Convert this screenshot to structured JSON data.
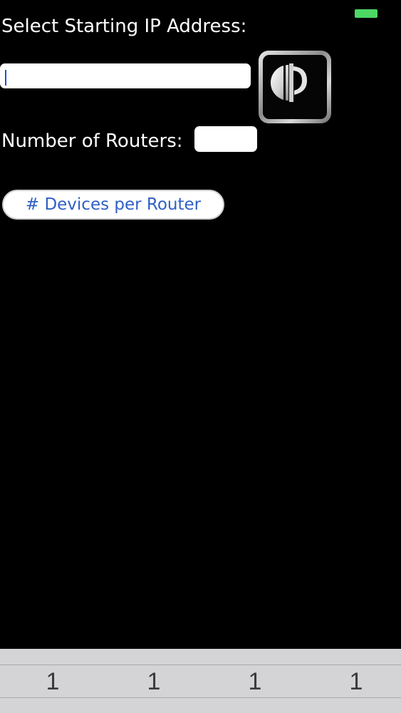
{
  "status_bar": {
    "battery_color": "#4cd964",
    "battery_icon": "battery-icon"
  },
  "form": {
    "ip_label": "Select Starting IP Address:",
    "ip_value": "",
    "routers_label": "Number of Routers:",
    "routers_value": "",
    "devices_button_label": "# Devices per Router"
  },
  "logo": {
    "icon": "ip-logo-icon",
    "accent": "#d9d9d9"
  },
  "picker": {
    "columns": [
      "1",
      "1",
      "1",
      "1"
    ]
  },
  "colors": {
    "background": "#000000",
    "text": "#ffffff",
    "button_text": "#2f5fc4",
    "picker_bg": "#d4d4d6"
  }
}
